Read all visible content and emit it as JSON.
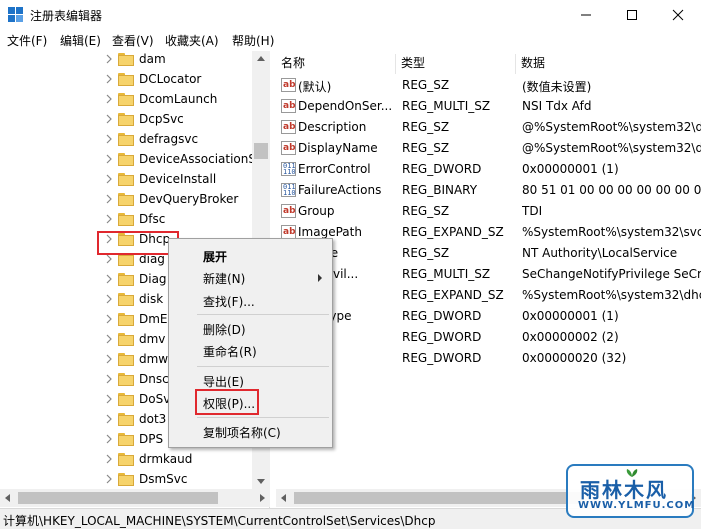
{
  "window": {
    "title": "注册表编辑器"
  },
  "menu": [
    "文件(F)",
    "编辑(E)",
    "查看(V)",
    "收藏夹(A)",
    "帮助(H)"
  ],
  "tree": {
    "items": [
      {
        "label": "dam",
        "partial": true
      },
      {
        "label": "DCLocator"
      },
      {
        "label": "DcomLaunch"
      },
      {
        "label": "DcpSvc"
      },
      {
        "label": "defragsvc"
      },
      {
        "label": "DeviceAssociationS"
      },
      {
        "label": "DeviceInstall"
      },
      {
        "label": "DevQueryBroker"
      },
      {
        "label": "Dfsc"
      },
      {
        "label": "Dhcp",
        "selected": true
      },
      {
        "label": "diag"
      },
      {
        "label": "Diag"
      },
      {
        "label": "disk"
      },
      {
        "label": "DmE"
      },
      {
        "label": "dmv"
      },
      {
        "label": "dmw"
      },
      {
        "label": "Dnsc"
      },
      {
        "label": "DoSv"
      },
      {
        "label": "dot3"
      },
      {
        "label": "DPS"
      },
      {
        "label": "drmkaud"
      },
      {
        "label": "DsmSvc"
      }
    ]
  },
  "list": {
    "headers": {
      "name": "名称",
      "type": "类型",
      "data": "数据"
    },
    "rows": [
      {
        "icon": "string-value-icon",
        "name": "(默认)",
        "type": "REG_SZ",
        "data": "(数值未设置)"
      },
      {
        "icon": "string-value-icon",
        "name": "DependOnSer...",
        "type": "REG_MULTI_SZ",
        "data": "NSI Tdx Afd"
      },
      {
        "icon": "string-value-icon",
        "name": "Description",
        "type": "REG_SZ",
        "data": "@%SystemRoot%\\system32\\dh"
      },
      {
        "icon": "string-value-icon",
        "name": "DisplayName",
        "type": "REG_SZ",
        "data": "@%SystemRoot%\\system32\\dh"
      },
      {
        "icon": "binary-value-icon",
        "name": "ErrorControl",
        "type": "REG_DWORD",
        "data": "0x00000001 (1)"
      },
      {
        "icon": "binary-value-icon",
        "name": "FailureActions",
        "type": "REG_BINARY",
        "data": "80 51 01 00 00 00 00 00 00 00"
      },
      {
        "icon": "string-value-icon",
        "name": "Group",
        "type": "REG_SZ",
        "data": "TDI"
      },
      {
        "icon": "string-value-icon",
        "name": "ImagePath",
        "type": "REG_EXPAND_SZ",
        "data": "%SystemRoot%\\system32\\svch"
      },
      {
        "icon": "string-value-icon",
        "name": "tName",
        "type": "REG_SZ",
        "data": "NT Authority\\LocalService"
      },
      {
        "icon": "string-value-icon",
        "name": "redPrivil...",
        "type": "REG_MULTI_SZ",
        "data": "SeChangeNotifyPrivilege SeCre"
      },
      {
        "icon": "string-value-icon",
        "name": "eDll",
        "type": "REG_EXPAND_SZ",
        "data": "%SystemRoot%\\system32\\dhcp"
      },
      {
        "icon": "binary-value-icon",
        "name": "eSidType",
        "type": "REG_DWORD",
        "data": "0x00000001 (1)"
      },
      {
        "icon": "binary-value-icon",
        "name": "",
        "type": "REG_DWORD",
        "data": "0x00000002 (2)"
      },
      {
        "icon": "binary-value-icon",
        "name": "",
        "type": "REG_DWORD",
        "data": "0x00000020 (32)"
      }
    ]
  },
  "context_menu": {
    "items": [
      {
        "label": "展开",
        "bold": true
      },
      {
        "label": "新建(N)",
        "submenu": true
      },
      {
        "label": "查找(F)..."
      },
      {
        "label": "删除(D)"
      },
      {
        "label": "重命名(R)"
      },
      {
        "label": "导出(E)"
      },
      {
        "label": "权限(P)...",
        "highlighted": true
      },
      {
        "label": "复制项名称(C)"
      }
    ]
  },
  "status": {
    "path": "计算机\\HKEY_LOCAL_MACHINE\\SYSTEM\\CurrentControlSet\\Services\\Dhcp"
  },
  "watermark": {
    "text": "雨林木风",
    "url": "WWW.YLMFU.COM"
  },
  "colors": {
    "highlight_box": "#e0282e",
    "folder": "#f6d36b",
    "watermark": "#1a5fa8"
  }
}
